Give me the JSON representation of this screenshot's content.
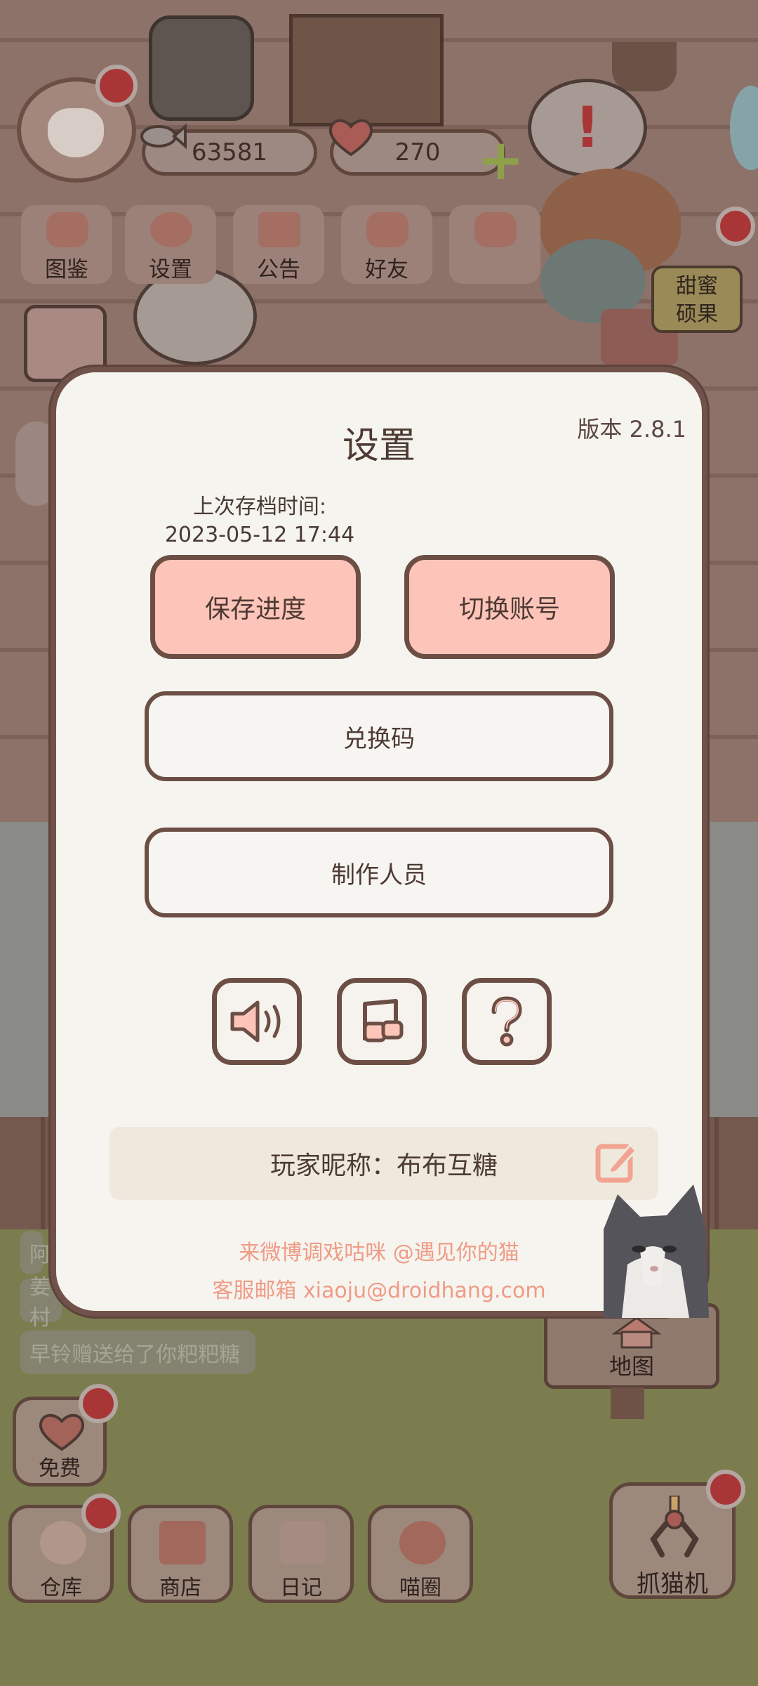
{
  "hud": {
    "fish_coins": "63581",
    "hearts": "270",
    "sweet_label_line1": "甜蜜",
    "sweet_label_line2": "硕果",
    "menu": [
      {
        "label": "图鉴",
        "icon": "cat-book-icon"
      },
      {
        "label": "设置",
        "icon": "gear-icon"
      },
      {
        "label": "公告",
        "icon": "gift-icon"
      },
      {
        "label": "好友",
        "icon": "friends-icon"
      }
    ]
  },
  "settings": {
    "title": "设置",
    "version": "版本 2.8.1",
    "save_time_label": "上次存档时间:",
    "save_time_value": "2023-05-12 17:44",
    "save_button": "保存进度",
    "switch_account_button": "切换账号",
    "redeem_code_button": "兑换码",
    "credits_button": "制作人员",
    "icons": [
      "speaker-icon",
      "music-note-icon",
      "help-icon"
    ],
    "nickname_label": "玩家昵称：",
    "nickname_value": "布布互糖",
    "promo_weibo": "来微博调戏咕咪 @遇见你的猫",
    "promo_email": "客服邮箱 xiaoju@droidhang.com"
  },
  "messages": {
    "msg1_fragment": "阿",
    "msg2_fragment": "姜村",
    "msg3": "早铃赠送给了你粑粑糖"
  },
  "bottom": {
    "free_label": "免费",
    "map_label": "地图",
    "nav": [
      {
        "label": "仓库",
        "icon": "rice-ball-icon"
      },
      {
        "label": "商店",
        "icon": "shop-icon"
      },
      {
        "label": "日记",
        "icon": "diary-icon"
      },
      {
        "label": "喵圈",
        "icon": "cat-planet-icon"
      }
    ],
    "claw_label": "抓猫机"
  },
  "colors": {
    "dialog_bg": "#f6f4ef",
    "dialog_border": "#71524a",
    "primary_button": "#fdc5b9",
    "promo_text": "#ef9b86"
  }
}
